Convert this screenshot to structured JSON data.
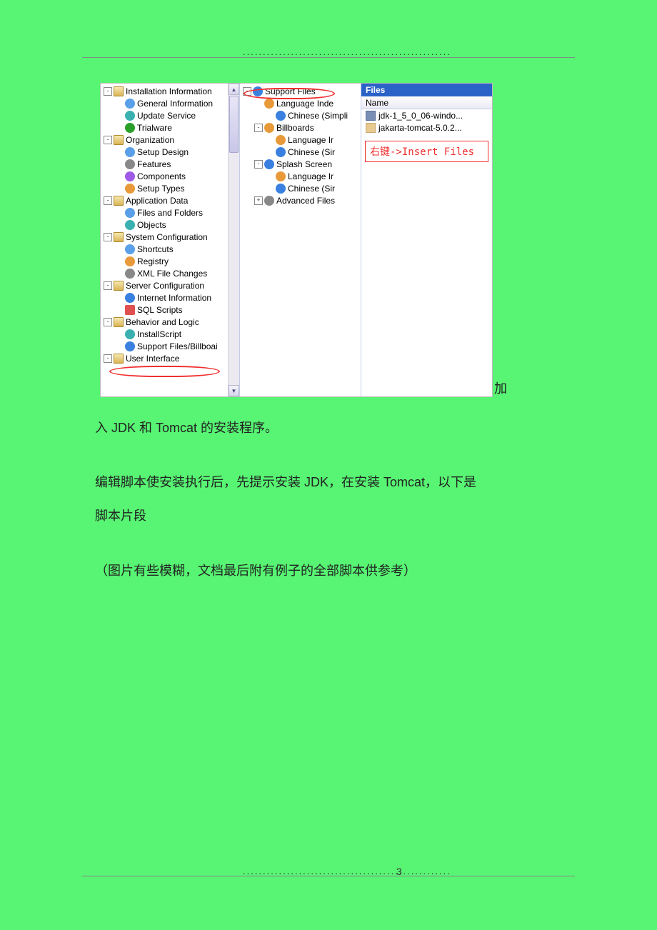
{
  "page_number": "3",
  "dots": "....................................................",
  "screenshot": {
    "left_tree": {
      "items": [
        {
          "toggle": "-",
          "indent": 0,
          "icon": "folder-open",
          "label": "Installation Information"
        },
        {
          "toggle": "",
          "indent": 1,
          "icon": "dot-blue",
          "label": "General Information"
        },
        {
          "toggle": "",
          "indent": 1,
          "icon": "dot-teal",
          "label": "Update Service"
        },
        {
          "toggle": "",
          "indent": 1,
          "icon": "dot-green",
          "label": "Trialware"
        },
        {
          "toggle": "-",
          "indent": 0,
          "icon": "folder-open",
          "label": "Organization"
        },
        {
          "toggle": "",
          "indent": 1,
          "icon": "dot-blue",
          "label": "Setup Design"
        },
        {
          "toggle": "",
          "indent": 1,
          "icon": "dot-gray",
          "label": "Features"
        },
        {
          "toggle": "",
          "indent": 1,
          "icon": "dot-purple",
          "label": "Components"
        },
        {
          "toggle": "",
          "indent": 1,
          "icon": "dot-orange",
          "label": "Setup Types"
        },
        {
          "toggle": "-",
          "indent": 0,
          "icon": "folder-open",
          "label": "Application Data"
        },
        {
          "toggle": "",
          "indent": 1,
          "icon": "dot-blue",
          "label": "Files and Folders"
        },
        {
          "toggle": "",
          "indent": 1,
          "icon": "dot-teal",
          "label": "Objects"
        },
        {
          "toggle": "-",
          "indent": 0,
          "icon": "folder-open",
          "label": "System Configuration"
        },
        {
          "toggle": "",
          "indent": 1,
          "icon": "dot-blue",
          "label": "Shortcuts"
        },
        {
          "toggle": "",
          "indent": 1,
          "icon": "dot-orange",
          "label": "Registry"
        },
        {
          "toggle": "",
          "indent": 1,
          "icon": "dot-gray",
          "label": "XML File Changes"
        },
        {
          "toggle": "-",
          "indent": 0,
          "icon": "folder-open",
          "label": "Server Configuration"
        },
        {
          "toggle": "",
          "indent": 1,
          "icon": "dot-world",
          "label": "Internet Information"
        },
        {
          "toggle": "",
          "indent": 1,
          "icon": "dot-sql",
          "label": "SQL Scripts"
        },
        {
          "toggle": "-",
          "indent": 0,
          "icon": "folder-open",
          "label": "Behavior and Logic"
        },
        {
          "toggle": "",
          "indent": 1,
          "icon": "dot-teal",
          "label": "InstallScript"
        },
        {
          "toggle": "",
          "indent": 1,
          "icon": "dot-world",
          "label": "Support Files/Billboai"
        },
        {
          "toggle": "-",
          "indent": 0,
          "icon": "folder-open",
          "label": "User Interface"
        }
      ]
    },
    "mid_tree": {
      "items": [
        {
          "toggle": "-",
          "indent": 0,
          "icon": "dot-world",
          "label": "Support Files"
        },
        {
          "toggle": "",
          "indent": 1,
          "icon": "dot-orange",
          "label": "Language Inde"
        },
        {
          "toggle": "",
          "indent": 2,
          "icon": "dot-world",
          "label": "Chinese (Simpli"
        },
        {
          "toggle": "-",
          "indent": 1,
          "icon": "dot-orange",
          "label": "Billboards"
        },
        {
          "toggle": "",
          "indent": 2,
          "icon": "dot-orange",
          "label": "Language Ir"
        },
        {
          "toggle": "",
          "indent": 2,
          "icon": "dot-world",
          "label": "Chinese (Sir"
        },
        {
          "toggle": "-",
          "indent": 1,
          "icon": "dot-world",
          "label": "Splash Screen"
        },
        {
          "toggle": "",
          "indent": 2,
          "icon": "dot-orange",
          "label": "Language Ir"
        },
        {
          "toggle": "",
          "indent": 2,
          "icon": "dot-world",
          "label": "Chinese (Sir"
        },
        {
          "toggle": "+",
          "indent": 1,
          "icon": "dot-gray",
          "label": "Advanced Files"
        }
      ]
    },
    "right": {
      "header": "Files",
      "col": "Name",
      "files": [
        {
          "icon": "jdk-icon",
          "name": "jdk-1_5_0_06-windo..."
        },
        {
          "icon": "tomcat-icon",
          "name": "jakarta-tomcat-5.0.2..."
        }
      ],
      "annotation": "右键->Insert Files"
    }
  },
  "body": {
    "inline_jia": "加",
    "p1": "入 JDK 和 Tomcat 的安装程序。",
    "p2": "编辑脚本使安装执行后，先提示安装 JDK，在安装 Tomcat，以下是",
    "p3": "脚本片段",
    "p4": "（图片有些模糊，文档最后附有例子的全部脚本供参考）"
  }
}
